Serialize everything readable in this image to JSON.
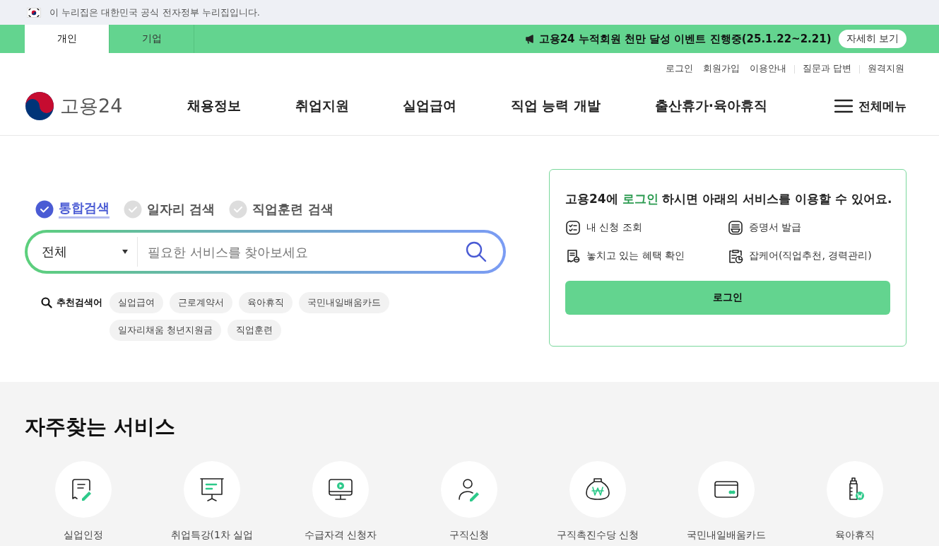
{
  "gov_banner": {
    "text": "이 누리집은 대한민국 공식 전자정부 누리집입니다."
  },
  "audience_tabs": [
    {
      "label": "개인",
      "selected": true
    },
    {
      "label": "기업",
      "selected": false
    }
  ],
  "notice": {
    "text": "고용24 누적회원 천만 달성 이벤트 진행중(25.1.22~2.21)",
    "button": "자세히 보기"
  },
  "util_links": [
    "로그인",
    "회원가입",
    "이용안내",
    "질문과 답변",
    "원격지원"
  ],
  "logo": {
    "text": "고용24"
  },
  "nav": [
    "채용정보",
    "취업지원",
    "실업급여",
    "직업 능력 개발",
    "출산휴가·육아휴직"
  ],
  "all_menu": "전체메뉴",
  "search_tabs": [
    {
      "label": "통합검색",
      "selected": true
    },
    {
      "label": "일자리 검색",
      "selected": false
    },
    {
      "label": "직업훈련 검색",
      "selected": false
    }
  ],
  "search": {
    "category": "전체",
    "placeholder": "필요한 서비스를 찾아보세요"
  },
  "recommended": {
    "label": "추천검색어",
    "chips": [
      "실업급여",
      "근로계약서",
      "육아휴직",
      "국민내일배움카드",
      "일자리채움 청년지원금",
      "직업훈련"
    ]
  },
  "login_card": {
    "title_start": "고용24에 ",
    "title_link": "로그인",
    "title_end": " 하시면 아래의 서비스를 이용할 수 있어요.",
    "features": [
      "내 신청 조회",
      "증명서 발급",
      "놓치고 있는 혜택 확인",
      "잡케어(직업추천, 경력관리)"
    ],
    "button": "로그인"
  },
  "services": {
    "title": "자주찾는 서비스",
    "items": [
      "실업인정",
      "취업특강(1차 실업",
      "수급자격 신청자",
      "구직신청",
      "구직촉진수당 신청",
      "국민내일배움카드",
      "육아휴직"
    ]
  }
}
